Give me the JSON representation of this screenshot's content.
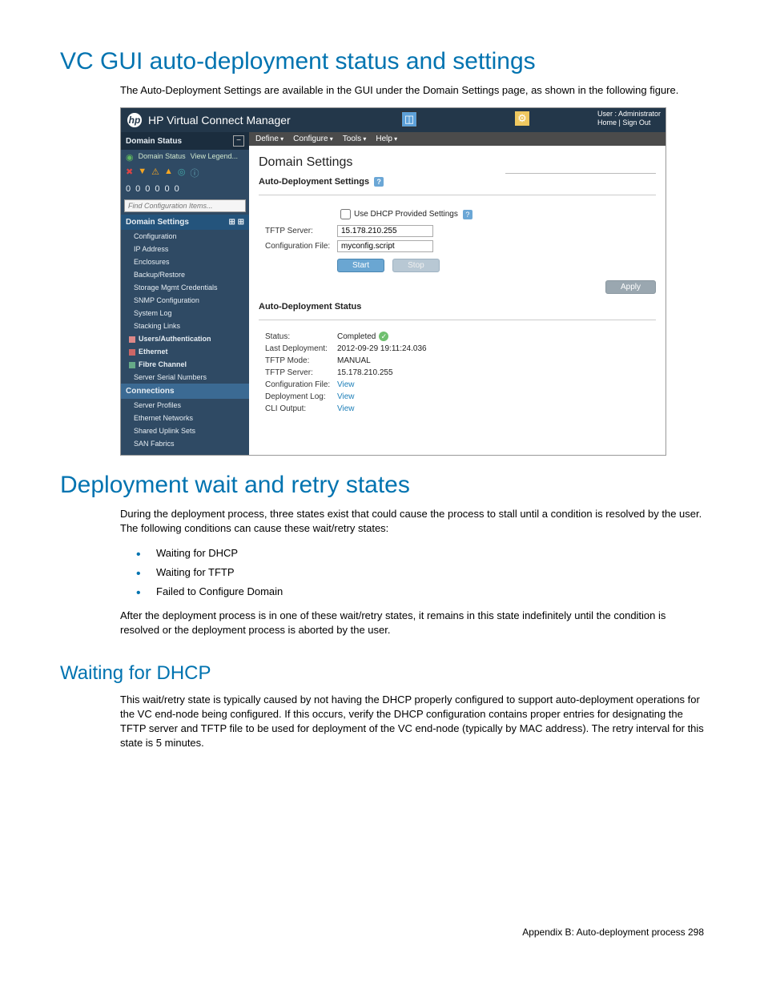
{
  "doc": {
    "h1": "VC GUI auto-deployment status and settings",
    "p1": "The Auto-Deployment Settings are available in the GUI under the Domain Settings page, as shown in the following figure.",
    "h1b": "Deployment wait and retry states",
    "p2": "During the deployment process, three states exist that could cause the process to stall until a condition is resolved by the user. The following conditions can cause these wait/retry states:",
    "bullets": [
      "Waiting for DHCP",
      "Waiting for TFTP",
      "Failed to Configure Domain"
    ],
    "p3": "After the deployment process is in one of these wait/retry states, it remains in this state indefinitely until the condition is resolved or the deployment process is aborted by the user.",
    "h2": "Waiting for DHCP",
    "p4": "This wait/retry state is typically caused by not having the DHCP properly configured to support auto-deployment operations for the VC end-node being configured. If this occurs, verify the DHCP configuration contains proper entries for designating the TFTP server and TFTP file to be used for deployment of the VC end-node (typically by MAC address). The retry interval for this state is 5 minutes.",
    "footer": "Appendix B: Auto-deployment process   298"
  },
  "ss": {
    "title": "HP Virtual Connect Manager",
    "user_line1": "User : Administrator",
    "user_home": "Home",
    "user_signout": "Sign Out",
    "menubar": [
      "Define",
      "Configure",
      "Tools",
      "Help"
    ],
    "sidebar": {
      "domain_status": "Domain Status",
      "status_link": "Domain Status",
      "view_legend": "View Legend...",
      "search_placeholder": "Find Configuration Items...",
      "settings_head": "Domain Settings",
      "items1": [
        "Configuration",
        "IP Address",
        "Enclosures",
        "Backup/Restore",
        "Storage Mgmt Credentials",
        "SNMP Configuration",
        "System Log",
        "Stacking Links"
      ],
      "users_auth": "Users/Authentication",
      "ethernet": "Ethernet",
      "fibre": "Fibre Channel",
      "serial": "Server Serial Numbers",
      "connections": "Connections",
      "items2": [
        "Server Profiles",
        "Ethernet Networks",
        "Shared Uplink Sets",
        "SAN Fabrics"
      ]
    },
    "main": {
      "page_title": "Domain Settings",
      "auto_dep_settings": "Auto-Deployment Settings",
      "use_dhcp": "Use DHCP Provided Settings",
      "tftp_label": "TFTP Server:",
      "tftp_value": "15.178.210.255",
      "cfgfile_label": "Configuration File:",
      "cfgfile_value": "myconfig.script",
      "btn_start": "Start",
      "btn_stop": "Stop",
      "btn_apply": "Apply",
      "auto_dep_status": "Auto-Deployment Status",
      "status_label": "Status:",
      "status_value": "Completed",
      "last_dep_label": "Last Deployment:",
      "last_dep_value": "2012-09-29 19:11:24.036",
      "tftp_mode_label": "TFTP Mode:",
      "tftp_mode_value": "MANUAL",
      "tftp2_label": "TFTP Server:",
      "tftp2_value": "15.178.210.255",
      "cfgfile2_label": "Configuration File:",
      "deplog_label": "Deployment Log:",
      "clioutput_label": "CLI Output:",
      "view": "View"
    }
  }
}
